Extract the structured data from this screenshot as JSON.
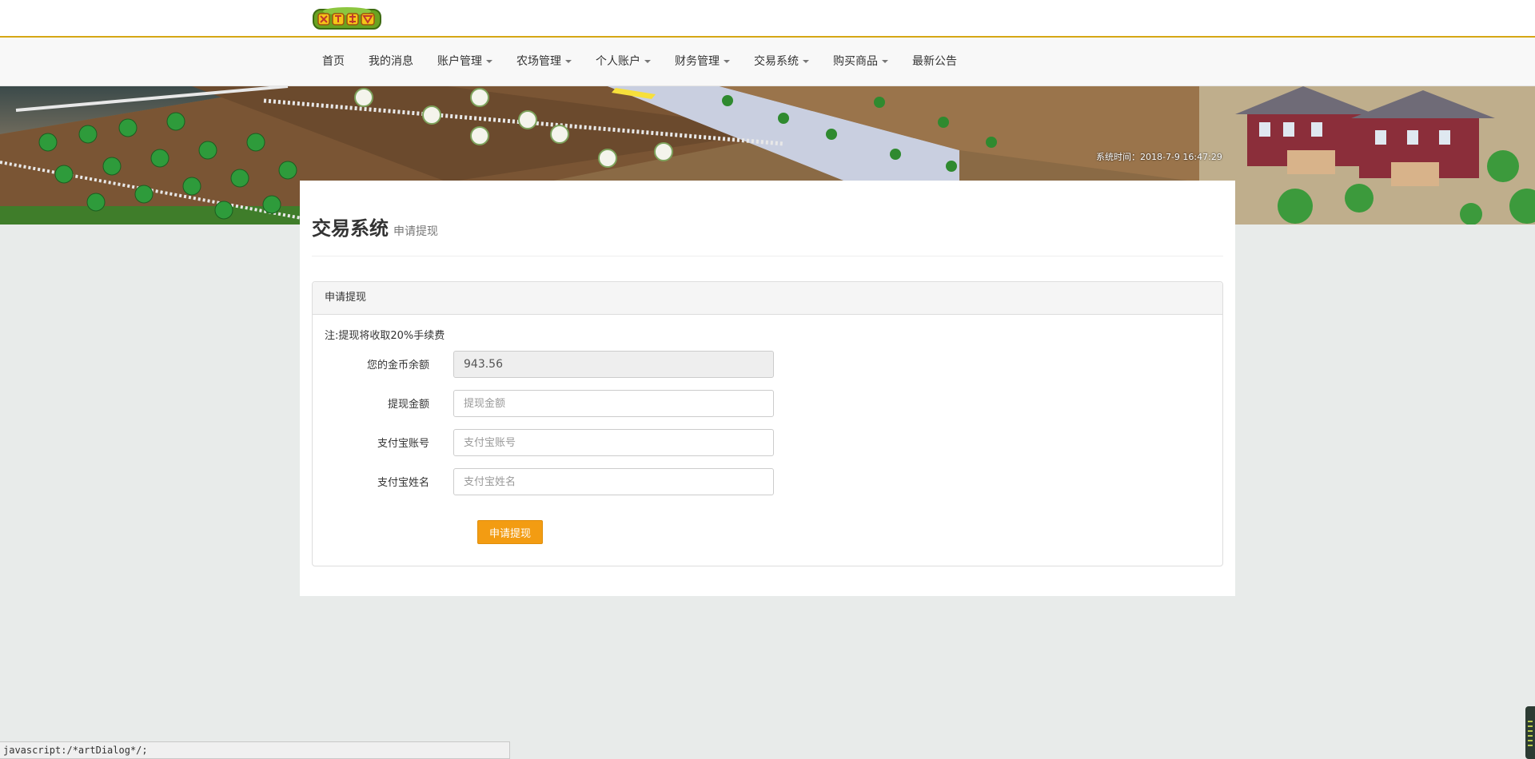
{
  "logo": {
    "text": "欢乐农场",
    "icon": "farm-logo-icon"
  },
  "nav": {
    "items": [
      {
        "label": "首页",
        "dropdown": false
      },
      {
        "label": "我的消息",
        "dropdown": false
      },
      {
        "label": "账户管理",
        "dropdown": true
      },
      {
        "label": "农场管理",
        "dropdown": true
      },
      {
        "label": "个人账户",
        "dropdown": true
      },
      {
        "label": "财务管理",
        "dropdown": true
      },
      {
        "label": "交易系统",
        "dropdown": true
      },
      {
        "label": "购买商品",
        "dropdown": true
      },
      {
        "label": "最新公告",
        "dropdown": false
      }
    ]
  },
  "banner": {
    "system_time": "系统时间：2018-7-9 16:47:29"
  },
  "page": {
    "title": "交易系统",
    "subtitle": "申请提现"
  },
  "panel": {
    "heading": "申请提现",
    "note": "注:提现将收取20%手续费",
    "fields": {
      "balance": {
        "label": "您的金币余额",
        "value": "943.56"
      },
      "amount": {
        "label": "提现金额",
        "placeholder": "提现金额"
      },
      "alipay_account": {
        "label": "支付宝账号",
        "placeholder": "支付宝账号"
      },
      "alipay_name": {
        "label": "支付宝姓名",
        "placeholder": "支付宝姓名"
      }
    },
    "submit_label": "申请提现"
  },
  "statusbar": {
    "text": "javascript:/*artDialog*/;"
  },
  "colors": {
    "accent": "#f39c12",
    "topbar_border": "#d6a715",
    "background": "#e8ebea"
  }
}
